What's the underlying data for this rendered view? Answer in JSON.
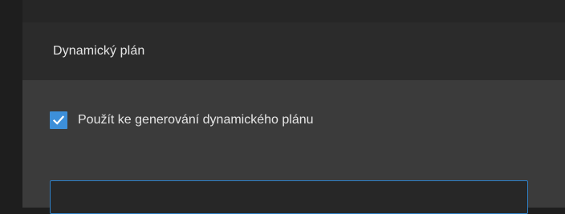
{
  "section": {
    "title": "Dynamický plán"
  },
  "option": {
    "checked": true,
    "label": "Použít ke generování dynamického plánu"
  },
  "input": {
    "value": "",
    "placeholder": ""
  },
  "colors": {
    "accent": "#3d8fd9",
    "input_border": "#2f7fc4"
  },
  "icons": {
    "checkbox_mark": "checkmark-icon"
  }
}
